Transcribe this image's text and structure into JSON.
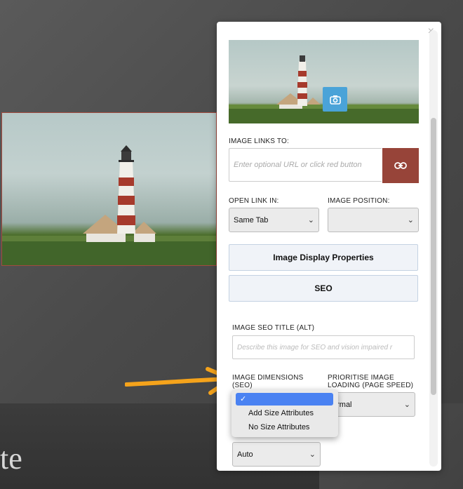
{
  "background": {
    "partial_heading": "te"
  },
  "panel": {
    "close_glyph": "×",
    "image_links_to": {
      "label": "IMAGE LINKS TO:",
      "placeholder": "Enter optional URL or click red button"
    },
    "open_link_in": {
      "label": "OPEN LINK IN:",
      "value": "Same Tab"
    },
    "image_position": {
      "label": "IMAGE POSITION:",
      "value": ""
    },
    "sections": {
      "display_properties": "Image Display Properties",
      "seo": "SEO"
    },
    "seo_title": {
      "label": "IMAGE SEO TITLE (ALT)",
      "placeholder": "Describe this image for SEO and vision impaired r"
    },
    "dimensions": {
      "label_line1": "IMAGE DIMENSIONS",
      "label_line2": "(SEO)"
    },
    "prioritise": {
      "label_line1": "PRIORITISE IMAGE",
      "label_line2": "LOADING (PAGE SPEED)",
      "value": "ormal"
    },
    "bottom_select": {
      "value": "Auto"
    }
  },
  "dropdown": {
    "checkmark": "✓",
    "options": [
      "Add Size Attributes",
      "No Size Attributes"
    ]
  },
  "colors": {
    "link_button": "#974439",
    "camera_button": "#4aa3d8",
    "selection_highlight": "#4a82f2",
    "arrow": "#f5a31b",
    "photo_border": "#a24b3f"
  },
  "icons": {
    "camera": "camera-icon",
    "link": "link-icon",
    "close": "close-icon",
    "chevron": "chevron-down-icon",
    "arrow": "arrow-right-icon"
  }
}
